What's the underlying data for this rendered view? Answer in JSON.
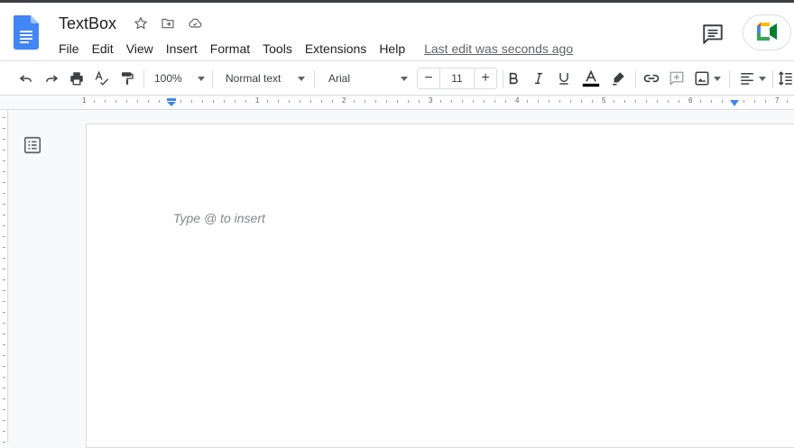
{
  "document": {
    "title": "TextBox",
    "placeholder": "Type @ to insert"
  },
  "menu": {
    "items": [
      "File",
      "Edit",
      "View",
      "Insert",
      "Format",
      "Tools",
      "Extensions",
      "Help"
    ],
    "last_edit": "Last edit was seconds ago"
  },
  "toolbar": {
    "zoom": "100%",
    "style": "Normal text",
    "font": "Arial",
    "font_size": "11",
    "text_color": "#000000"
  },
  "ruler": {
    "numbers": [
      "1",
      "1",
      "2",
      "3",
      "4",
      "5",
      "6",
      "7"
    ]
  },
  "colors": {
    "doc_blue": "#4285f4",
    "ruler_marker": "#4285f4"
  }
}
